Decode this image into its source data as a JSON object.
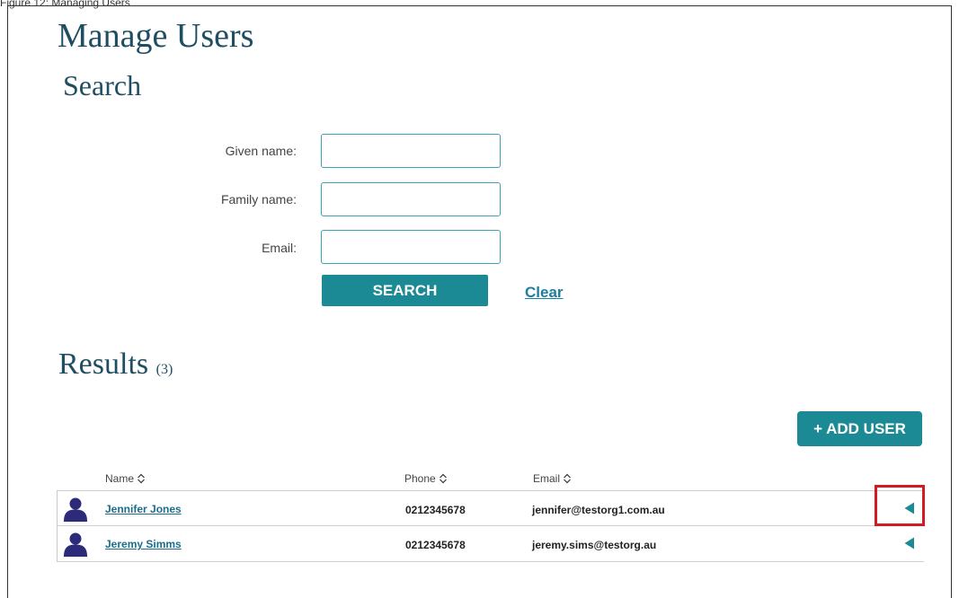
{
  "caption": "Figure 12: Managing Users",
  "page": {
    "title": "Manage Users",
    "search_heading": "Search"
  },
  "search_form": {
    "given_name_label": "Given name:",
    "given_name_value": "",
    "family_name_label": "Family name:",
    "family_name_value": "",
    "email_label": "Email:",
    "email_value": "",
    "search_button": "SEARCH",
    "clear_link": "Clear"
  },
  "results": {
    "heading": "Results",
    "count": "(3)",
    "add_user_button": "+ ADD USER",
    "columns": {
      "name": "Name",
      "phone": "Phone",
      "email": "Email"
    },
    "rows": [
      {
        "name": "Jennifer Jones",
        "phone": "0212345678",
        "email": "jennifer@testorg1.com.au"
      },
      {
        "name": "Jeremy Simms",
        "phone": "0212345678",
        "email": "jeremy.sims@testorg.au"
      }
    ]
  },
  "icons": {
    "avatar": "user-silhouette-icon",
    "sort": "sort-up-down-icon",
    "expand": "triangle-left-icon",
    "avatar_color": "#2e2a7a",
    "accent_color": "#1c8a95",
    "highlight_color": "#d41b22"
  }
}
